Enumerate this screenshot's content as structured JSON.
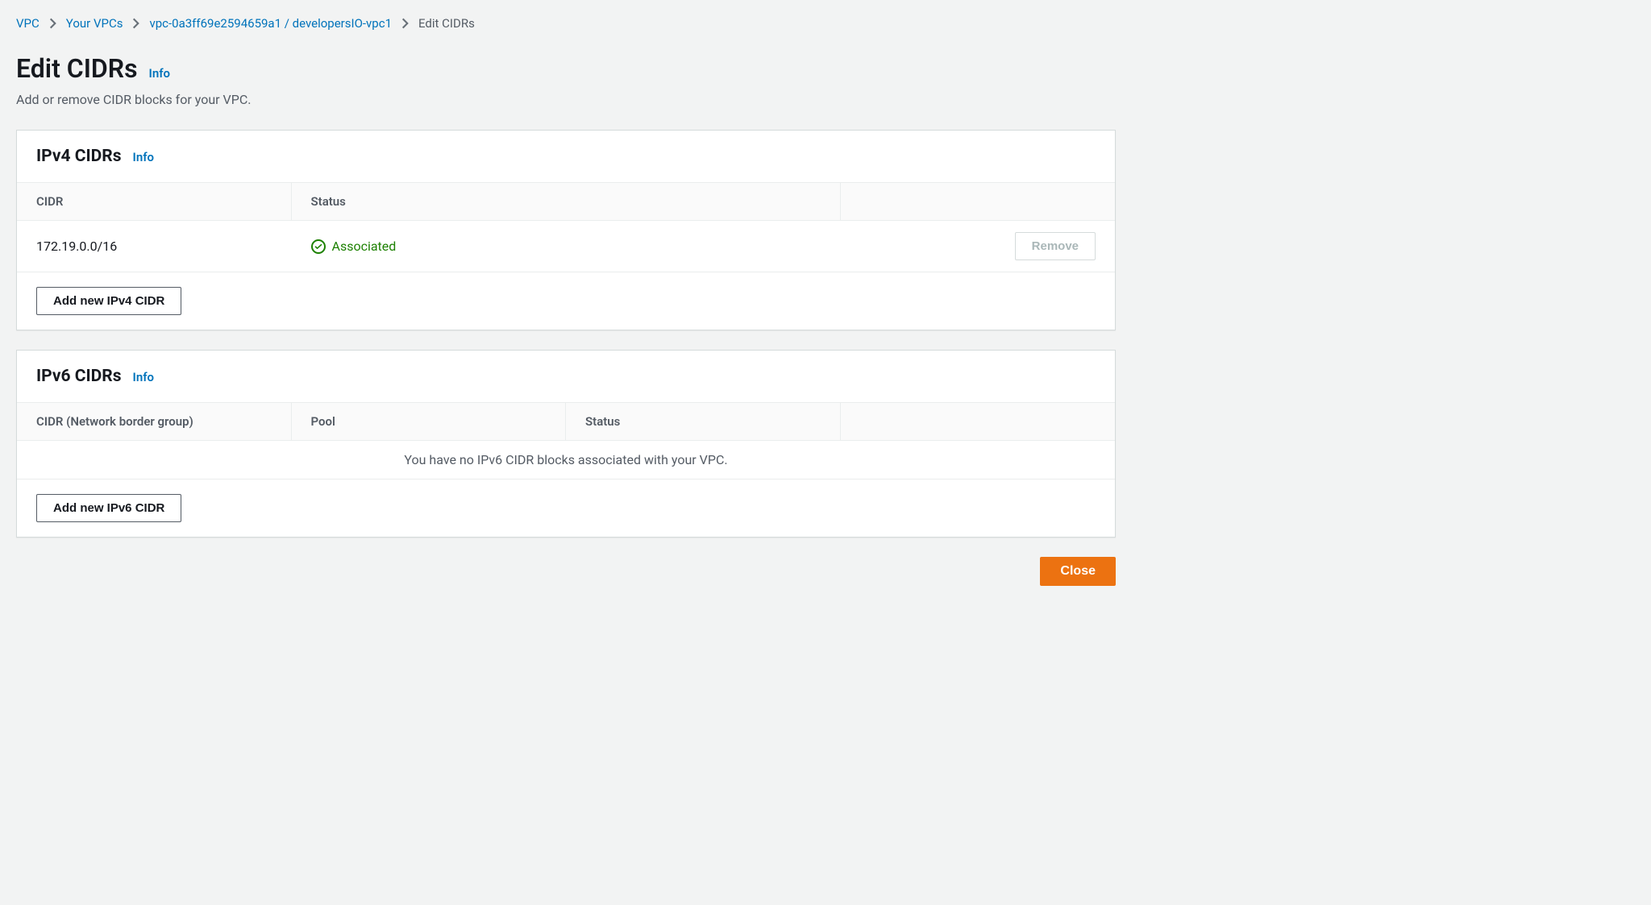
{
  "breadcrumb": {
    "items": [
      {
        "label": "VPC"
      },
      {
        "label": "Your VPCs"
      },
      {
        "label": "vpc-0a3ff69e2594659a1 / developersIO-vpc1"
      }
    ],
    "current": "Edit CIDRs"
  },
  "header": {
    "title": "Edit CIDRs",
    "info": "Info",
    "description": "Add or remove CIDR blocks for your VPC."
  },
  "ipv4": {
    "title": "IPv4 CIDRs",
    "info": "Info",
    "columns": {
      "cidr": "CIDR",
      "status": "Status"
    },
    "rows": [
      {
        "cidr": "172.19.0.0/16",
        "status": "Associated",
        "remove": "Remove"
      }
    ],
    "add": "Add new IPv4 CIDR"
  },
  "ipv6": {
    "title": "IPv6 CIDRs",
    "info": "Info",
    "columns": {
      "cidr": "CIDR (Network border group)",
      "pool": "Pool",
      "status": "Status"
    },
    "empty": "You have no IPv6 CIDR blocks associated with your VPC.",
    "add": "Add new IPv6 CIDR"
  },
  "actions": {
    "close": "Close"
  }
}
